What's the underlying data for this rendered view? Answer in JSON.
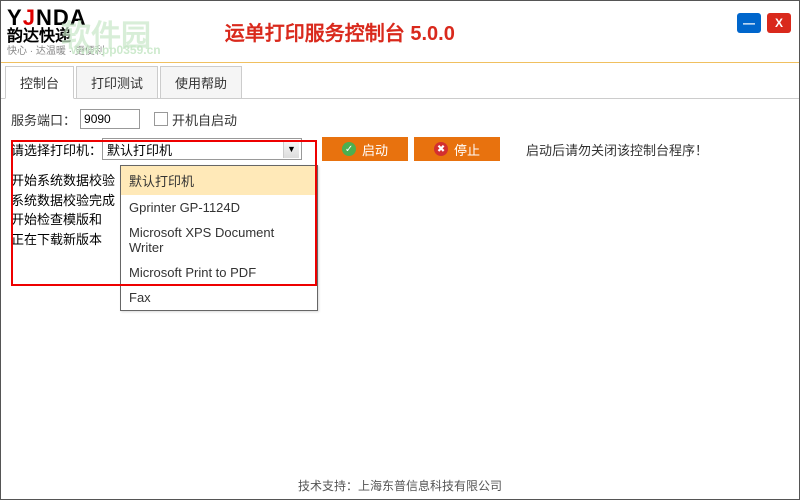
{
  "header": {
    "logo_line1_prefix": "Y",
    "logo_line1_j": "J",
    "logo_line1_suffix": "NDA",
    "logo_line2": "韵达快递",
    "watermark": "软件园",
    "watermark_url": "www.pp0359.cn",
    "tagline": "快心 · 达温暖 · 更便利",
    "title": "运单打印服务控制台 5.0.0"
  },
  "tabs": [
    {
      "label": "控制台",
      "active": true
    },
    {
      "label": "打印测试",
      "active": false
    },
    {
      "label": "使用帮助",
      "active": false
    }
  ],
  "port": {
    "label": "服务端口：",
    "value": "9090",
    "autostart_label": "开机自启动"
  },
  "printer": {
    "label": "请选择打印机：",
    "value": "默认打印机",
    "options": [
      "默认打印机",
      "Gprinter GP-1124D",
      "Microsoft XPS Document Writer",
      "Microsoft Print to PDF",
      "Fax"
    ]
  },
  "actions": {
    "start": "启动",
    "stop": "停止",
    "warning": "启动后请勿关闭该控制台程序！"
  },
  "log": [
    "开始系统数据校验",
    "系统数据校验完成",
    "开始检查模版和",
    "正在下载新版本"
  ],
  "footer": {
    "label": "技术支持：",
    "company": "上海东普信息科技有限公司"
  }
}
